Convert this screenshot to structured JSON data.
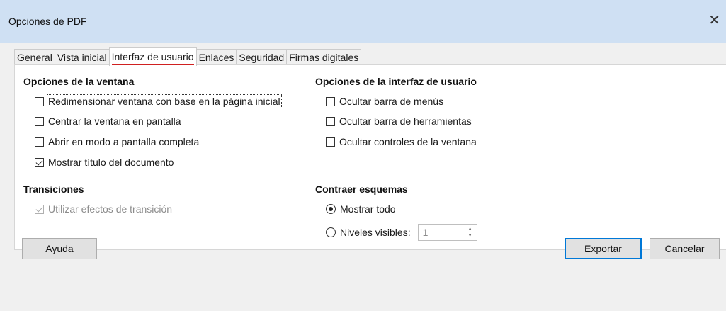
{
  "window": {
    "title": "Opciones de PDF",
    "close_glyph": "✕"
  },
  "tabs": [
    {
      "label": "General"
    },
    {
      "label": "Vista inicial"
    },
    {
      "label": "Interfaz de usuario",
      "active": true
    },
    {
      "label": "Enlaces"
    },
    {
      "label": "Seguridad"
    },
    {
      "label": "Firmas digitales"
    }
  ],
  "window_options": {
    "heading": "Opciones de la ventana",
    "items": [
      {
        "label": "Redimensionar ventana con base en la página inicial",
        "checked": false
      },
      {
        "label": "Centrar la ventana en pantalla",
        "checked": false
      },
      {
        "label": "Abrir en modo a pantalla completa",
        "checked": false
      },
      {
        "label": "Mostrar título del documento",
        "checked": true
      }
    ]
  },
  "ui_options": {
    "heading": "Opciones de la interfaz de usuario",
    "items": [
      {
        "label": "Ocultar barra de menús",
        "checked": false
      },
      {
        "label": "Ocultar barra de herramientas",
        "checked": false
      },
      {
        "label": "Ocultar controles de la ventana",
        "checked": false
      }
    ]
  },
  "transitions": {
    "heading": "Transiciones",
    "use_effects": {
      "label": "Utilizar efectos de transición",
      "checked": true,
      "disabled": true
    }
  },
  "collapse_outlines": {
    "heading": "Contraer esquemas",
    "show_all": {
      "label": "Mostrar todo",
      "selected": true
    },
    "visible_levels": {
      "label": "Niveles visibles:",
      "selected": false,
      "value": "1"
    }
  },
  "buttons": {
    "help": "Ayuda",
    "export": "Exportar",
    "cancel": "Cancelar"
  },
  "colors": {
    "titlebar": "#cfe0f3",
    "tab_underline": "#d02020",
    "default_button_border": "#0078d7"
  }
}
